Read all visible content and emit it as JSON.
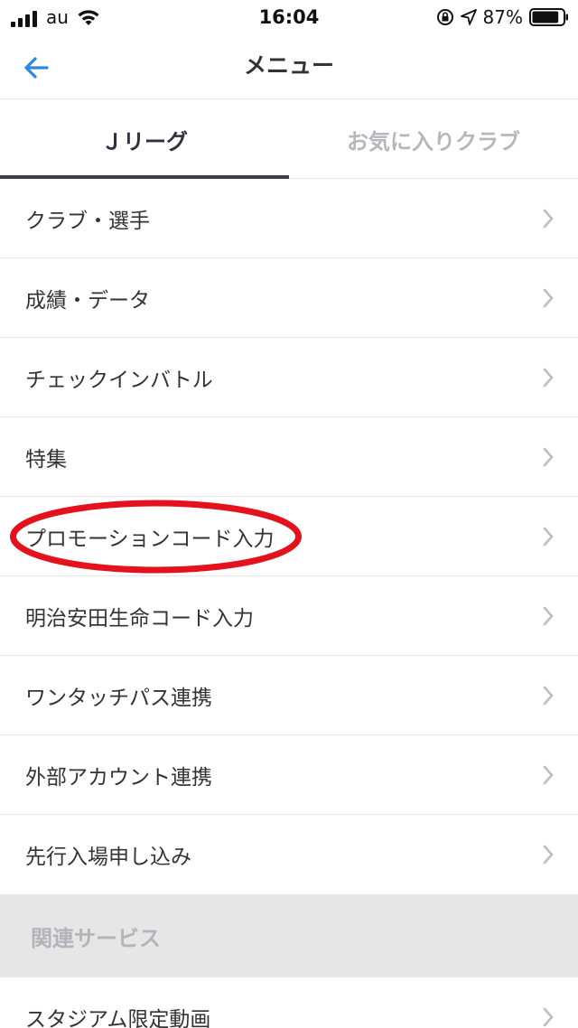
{
  "status_bar": {
    "carrier": "au",
    "time": "16:04",
    "battery_percent": "87%",
    "battery_level": 0.87,
    "icons": [
      "signal-icon",
      "wifi-icon",
      "rotation-lock-icon",
      "location-icon",
      "battery-icon"
    ]
  },
  "nav": {
    "title": "メニュー",
    "back_icon": "back-arrow-icon"
  },
  "tabs": [
    {
      "label": "Ｊリーグ",
      "active": true
    },
    {
      "label": "お気に入りクラブ",
      "active": false
    }
  ],
  "menu": {
    "items": [
      {
        "label": "クラブ・選手"
      },
      {
        "label": "成績・データ"
      },
      {
        "label": "チェックインバトル"
      },
      {
        "label": "特集"
      },
      {
        "label": "プロモーションコード入力",
        "highlighted": true
      },
      {
        "label": "明治安田生命コード入力"
      },
      {
        "label": "ワンタッチパス連携"
      },
      {
        "label": "外部アカウント連携"
      },
      {
        "label": "先行入場申し込み"
      }
    ]
  },
  "related": {
    "section_title": "関連サービス",
    "items": [
      {
        "label": "スタジアム限定動画"
      }
    ]
  },
  "colors": {
    "accent_blue": "#2d86e0",
    "highlight_red": "#e3121c",
    "tab_active": "#2f3140",
    "tab_inactive": "#b6b6bd",
    "chevron": "#bdbdc2",
    "section_bg": "#e6e6e6"
  }
}
